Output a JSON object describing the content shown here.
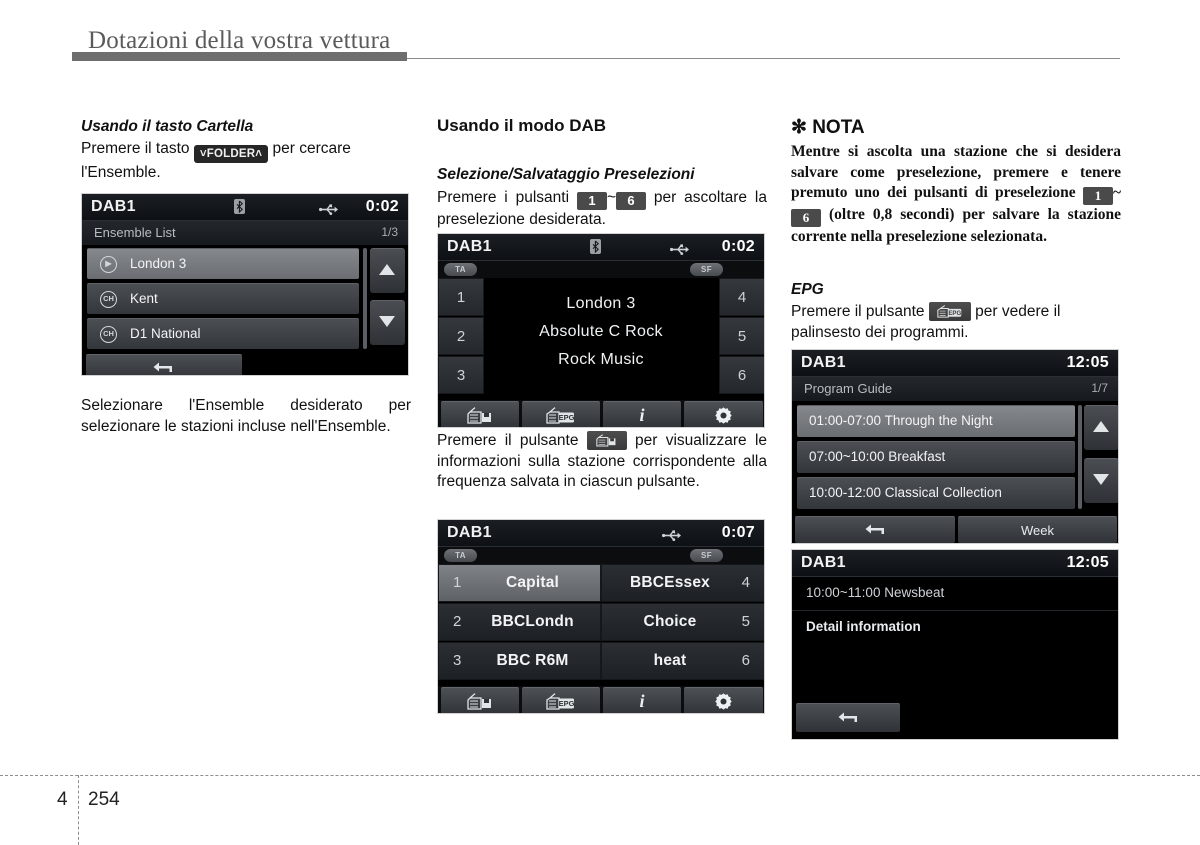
{
  "header": {
    "title": "Dotazioni della vostra vettura"
  },
  "footer": {
    "chapter": "4",
    "page": "254"
  },
  "col1": {
    "heading": "Usando il tasto Cartella",
    "para_before": "Premere il tasto",
    "folder_key": "FOLDER",
    "para_after": "per cercare l'Ensemble.",
    "caption": "Selezionare l'Ensemble desiderato per selezionare le stazioni incluse nell'Ensemble.",
    "screen": {
      "source": "DAB1",
      "clock": "0:02",
      "title": "Ensemble List",
      "page_indicator": "1/3",
      "bt_icon": "bluetooth-icon",
      "usb_icon": "usb-icon",
      "items": [
        {
          "label": "London 3",
          "icon": "play-circle-icon",
          "selected": true
        },
        {
          "label": "Kent",
          "icon": "ch-circle-icon",
          "selected": false
        },
        {
          "label": "D1 National",
          "icon": "ch-circle-icon",
          "selected": false
        }
      ],
      "back_icon": "back-arrow-icon",
      "up_icon": "triangle-up-icon",
      "down_icon": "triangle-down-icon"
    }
  },
  "col2": {
    "heading": "Usando il modo DAB",
    "sub1": "Selezione/Salvataggio Preselezioni",
    "p1_a": "Premere i pulsanti",
    "p1_key1": "1",
    "p1_tilde": "~",
    "p1_key6": "6",
    "p1_b": "per ascoltare la preselezione desiderata.",
    "p2_a": "Premere il pulsante",
    "p2_key_icon": "radio-info-icon",
    "p2_b": "per visualizzare le informazioni sulla stazione corrispondente alla frequenza salvata in ciascun pulsante.",
    "screen_preset": {
      "source": "DAB1",
      "clock": "0:02",
      "bt_icon": "bluetooth-icon",
      "usb_icon": "usb-icon",
      "tag_left": "TA",
      "tag_right": "SF",
      "left_numbers": [
        "1",
        "2",
        "3"
      ],
      "right_numbers": [
        "4",
        "5",
        "6"
      ],
      "center_lines": [
        "London 3",
        "Absolute C Rock",
        "Rock Music"
      ],
      "toolbar_icons": [
        "radio-info-icon",
        "radio-epg-icon",
        "info-i-icon",
        "settings-gear-icon"
      ]
    },
    "screen_stations": {
      "source": "DAB1",
      "clock": "0:07",
      "usb_icon": "usb-icon",
      "tag_left": "TA",
      "tag_right": "SF",
      "rows": [
        {
          "left_index": "1",
          "left_name": "Capital",
          "right_name": "BBCEssex",
          "right_index": "4",
          "selected": true
        },
        {
          "left_index": "2",
          "left_name": "BBCLondn",
          "right_name": "Choice",
          "right_index": "5",
          "selected": false
        },
        {
          "left_index": "3",
          "left_name": "BBC R6M",
          "right_name": "heat",
          "right_index": "6",
          "selected": false
        }
      ],
      "toolbar_icons": [
        "radio-info-icon",
        "radio-epg-icon",
        "info-i-icon",
        "settings-gear-icon"
      ]
    }
  },
  "col3": {
    "note_marker": "✻",
    "note_title": "NOTA",
    "note_a": "Mentre si ascolta una stazione che si desidera salvare come preselezione, premere e tenere premuto uno dei pulsanti di preselezione",
    "note_key1": "1",
    "note_tilde": "~",
    "note_key6": "6",
    "note_b": "(oltre 0,8 secondi) per salvare la stazione corrente nella preselezione selezionata.",
    "epg_heading": "EPG",
    "epg_a": "Premere il pulsante",
    "epg_key_icon": "radio-epg-icon",
    "epg_b": "per vedere il palinsesto dei programmi.",
    "screen_guide": {
      "source": "DAB1",
      "clock": "12:05",
      "title": "Program Guide",
      "page_indicator": "1/7",
      "items": [
        {
          "label": "01:00-07:00 Through the Night",
          "selected": true
        },
        {
          "label": "07:00~10:00 Breakfast",
          "selected": false
        },
        {
          "label": "10:00-12:00 Classical Collection",
          "selected": false
        }
      ],
      "back_icon": "back-arrow-icon",
      "week_label": "Week",
      "up_icon": "triangle-up-icon",
      "down_icon": "triangle-down-icon"
    },
    "screen_detail": {
      "source": "DAB1",
      "clock": "12:05",
      "program": "10:00~11:00 Newsbeat",
      "detail": "Detail information",
      "back_icon": "back-arrow-icon"
    }
  },
  "colors": {
    "rule": "#8a8a8a",
    "header_text": "#5a5a5a",
    "screen_bg": "#000000",
    "accent_selected": "#85888c"
  }
}
